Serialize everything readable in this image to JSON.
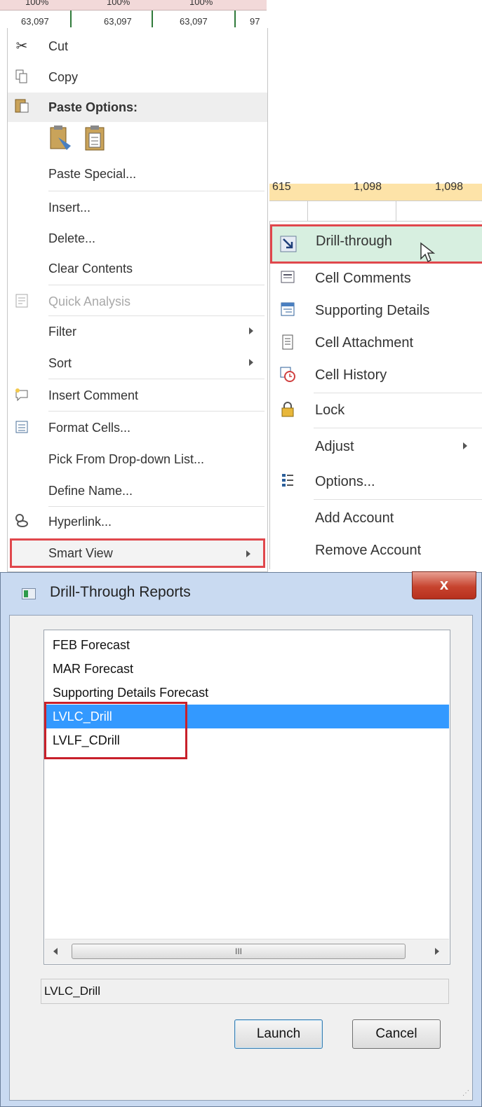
{
  "sheet": {
    "top_values": [
      "100%",
      "100%",
      "100%"
    ],
    "cell_values": [
      "63,097",
      "63,097",
      "63,097",
      "97"
    ]
  },
  "context_menu": {
    "items": [
      {
        "label": "Cut",
        "icon": "scissors-icon"
      },
      {
        "label": "Copy",
        "icon": "copy-icon"
      },
      {
        "label": "Paste Options:",
        "icon": "paste-icon"
      },
      {
        "label": "Paste Special...",
        "icon": ""
      },
      {
        "label": "Insert...",
        "icon": ""
      },
      {
        "label": "Delete...",
        "icon": ""
      },
      {
        "label": "Clear Contents",
        "icon": ""
      },
      {
        "label": "Quick Analysis",
        "icon": "quick-analysis-icon"
      },
      {
        "label": "Filter",
        "icon": ""
      },
      {
        "label": "Sort",
        "icon": ""
      },
      {
        "label": "Insert Comment",
        "icon": "insert-comment-icon"
      },
      {
        "label": "Format Cells...",
        "icon": "format-cells-icon"
      },
      {
        "label": "Pick From Drop-down List...",
        "icon": ""
      },
      {
        "label": "Define Name...",
        "icon": ""
      },
      {
        "label": "Hyperlink...",
        "icon": "hyperlink-icon"
      },
      {
        "label": "Smart View",
        "icon": ""
      }
    ]
  },
  "submenu_sheet": {
    "values": [
      "615",
      "1,098",
      "1,098"
    ]
  },
  "submenu": {
    "items": [
      {
        "label": "Drill-through",
        "icon": "drill-through-icon"
      },
      {
        "label": "Cell Comments",
        "icon": "cell-comments-icon"
      },
      {
        "label": "Supporting Details",
        "icon": "supporting-details-icon"
      },
      {
        "label": "Cell Attachment",
        "icon": "cell-attachment-icon"
      },
      {
        "label": "Cell History",
        "icon": "cell-history-icon"
      },
      {
        "label": "Lock",
        "icon": "lock-icon"
      },
      {
        "label": "Adjust",
        "icon": ""
      },
      {
        "label": "Options...",
        "icon": "options-icon"
      },
      {
        "label": "Add Account",
        "icon": ""
      },
      {
        "label": "Remove Account",
        "icon": ""
      }
    ]
  },
  "dialog": {
    "title": "Drill-Through Reports",
    "close_label": "x",
    "reports": [
      "FEB Forecast",
      "MAR Forecast",
      "Supporting Details Forecast",
      "LVLC_Drill",
      "LVLF_CDrill"
    ],
    "selected_index": 3,
    "scroll_thumb_label": "III",
    "selected_value": "LVLC_Drill",
    "launch_label": "Launch",
    "cancel_label": "Cancel"
  },
  "colors": {
    "highlight_red": "#e0474c",
    "selection_blue": "#3399ff",
    "drill_hover_green": "#d7efe0"
  }
}
